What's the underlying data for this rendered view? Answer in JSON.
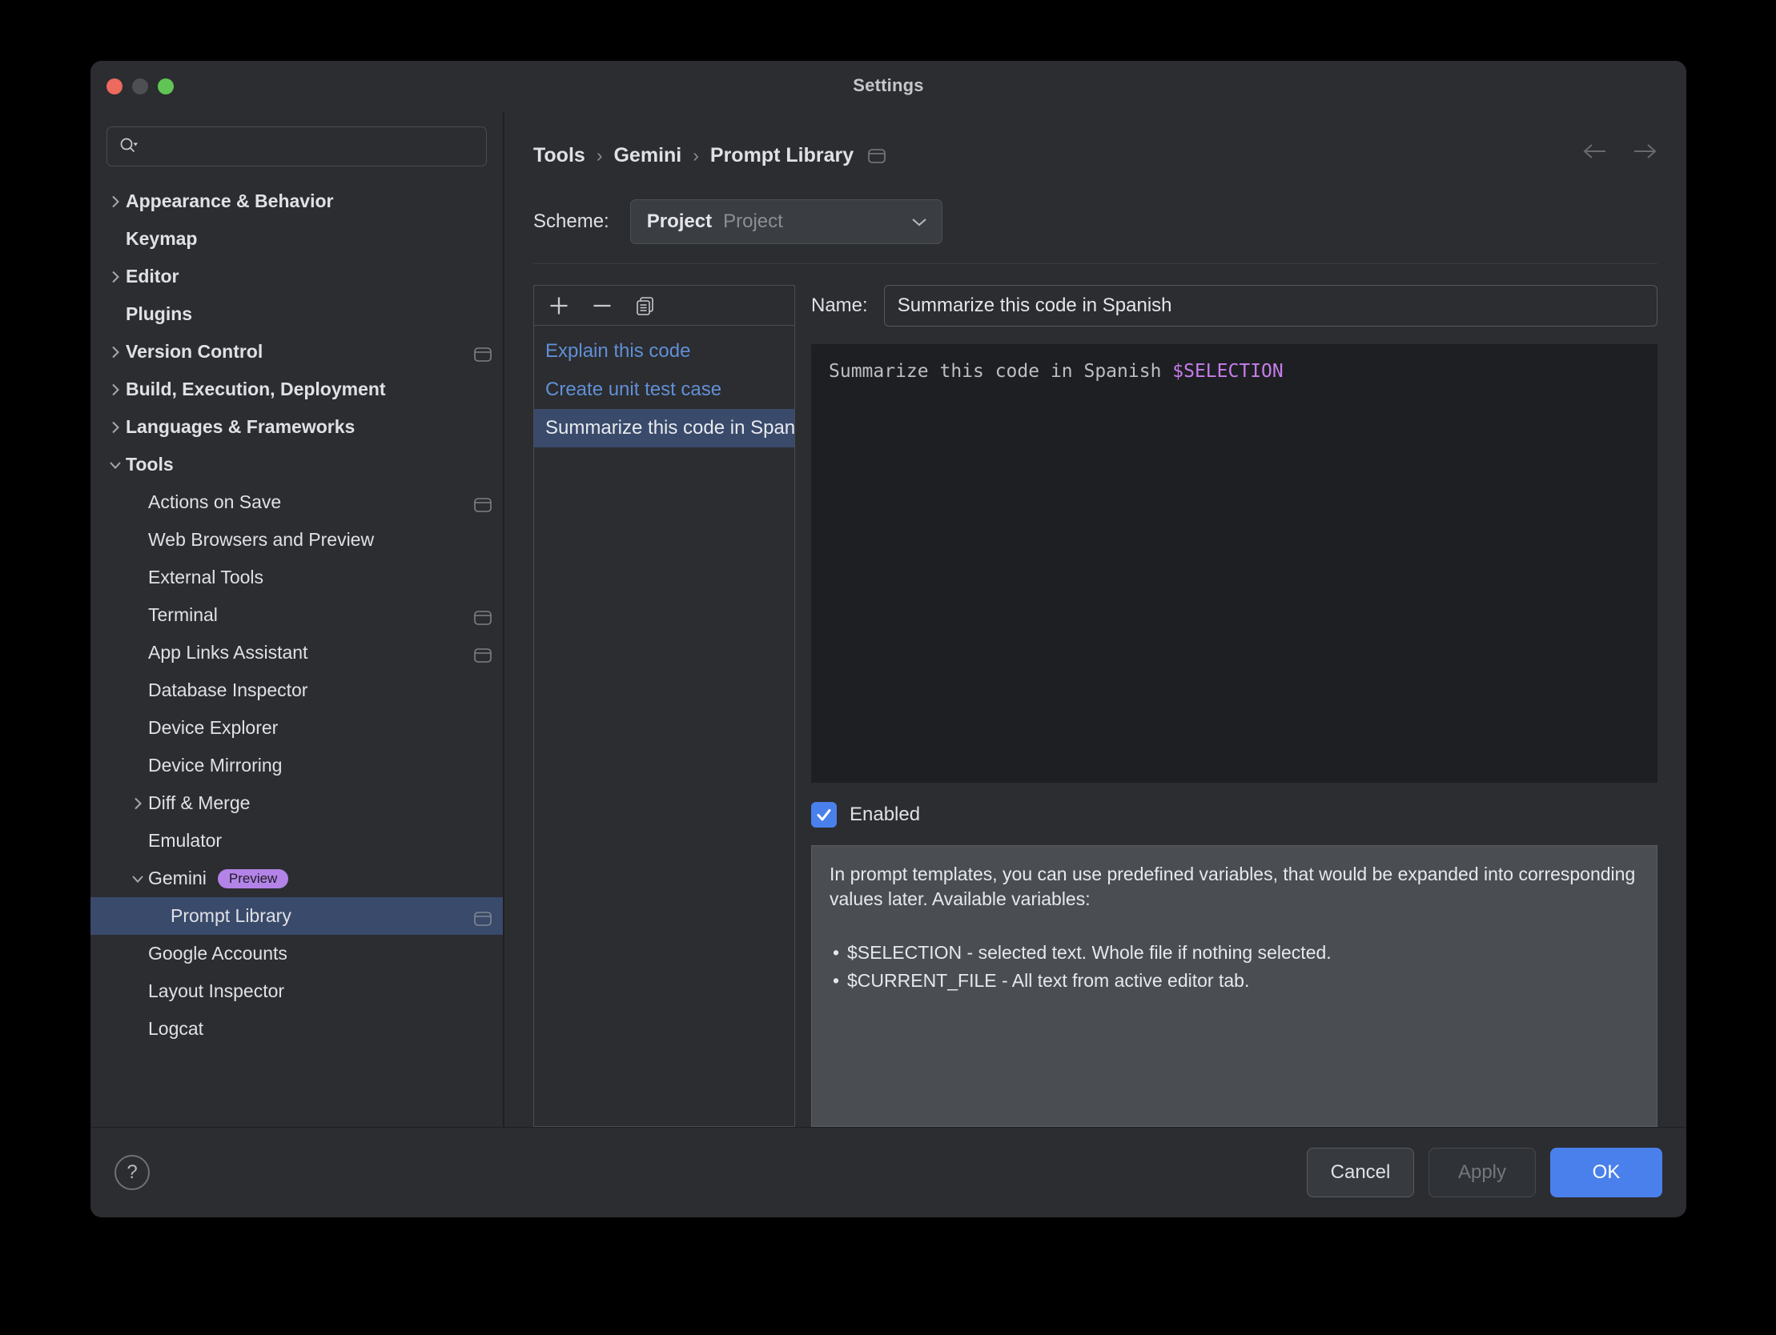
{
  "window": {
    "title": "Settings",
    "traffic_lights": [
      "close-button",
      "minimize-button",
      "maximize-button"
    ]
  },
  "sidebar": {
    "search": {
      "placeholder": "",
      "value": "",
      "icon": "search-icon"
    },
    "items": [
      {
        "label": "Appearance & Behavior",
        "level": 0,
        "arrow": "right",
        "bold": true,
        "scope": false,
        "selected": false
      },
      {
        "label": "Keymap",
        "level": 0,
        "arrow": "none",
        "bold": true,
        "scope": false,
        "selected": false
      },
      {
        "label": "Editor",
        "level": 0,
        "arrow": "right",
        "bold": true,
        "scope": false,
        "selected": false
      },
      {
        "label": "Plugins",
        "level": 0,
        "arrow": "none",
        "bold": true,
        "scope": false,
        "selected": false
      },
      {
        "label": "Version Control",
        "level": 0,
        "arrow": "right",
        "bold": true,
        "scope": true,
        "selected": false
      },
      {
        "label": "Build, Execution, Deployment",
        "level": 0,
        "arrow": "right",
        "bold": true,
        "scope": false,
        "selected": false
      },
      {
        "label": "Languages & Frameworks",
        "level": 0,
        "arrow": "right",
        "bold": true,
        "scope": false,
        "selected": false
      },
      {
        "label": "Tools",
        "level": 0,
        "arrow": "down",
        "bold": true,
        "scope": false,
        "selected": false
      },
      {
        "label": "Actions on Save",
        "level": 1,
        "arrow": "none",
        "bold": false,
        "scope": true,
        "selected": false
      },
      {
        "label": "Web Browsers and Preview",
        "level": 1,
        "arrow": "none",
        "bold": false,
        "scope": false,
        "selected": false
      },
      {
        "label": "External Tools",
        "level": 1,
        "arrow": "none",
        "bold": false,
        "scope": false,
        "selected": false
      },
      {
        "label": "Terminal",
        "level": 1,
        "arrow": "none",
        "bold": false,
        "scope": true,
        "selected": false
      },
      {
        "label": "App Links Assistant",
        "level": 1,
        "arrow": "none",
        "bold": false,
        "scope": true,
        "selected": false
      },
      {
        "label": "Database Inspector",
        "level": 1,
        "arrow": "none",
        "bold": false,
        "scope": false,
        "selected": false
      },
      {
        "label": "Device Explorer",
        "level": 1,
        "arrow": "none",
        "bold": false,
        "scope": false,
        "selected": false
      },
      {
        "label": "Device Mirroring",
        "level": 1,
        "arrow": "none",
        "bold": false,
        "scope": false,
        "selected": false
      },
      {
        "label": "Diff & Merge",
        "level": 1,
        "arrow": "right",
        "bold": false,
        "scope": false,
        "selected": false
      },
      {
        "label": "Emulator",
        "level": 1,
        "arrow": "none",
        "bold": false,
        "scope": false,
        "selected": false
      },
      {
        "label": "Gemini",
        "level": 1,
        "arrow": "down",
        "bold": false,
        "scope": false,
        "selected": false,
        "badge": "Preview"
      },
      {
        "label": "Prompt Library",
        "level": 2,
        "arrow": "none",
        "bold": false,
        "scope": true,
        "selected": true
      },
      {
        "label": "Google Accounts",
        "level": 1,
        "arrow": "none",
        "bold": false,
        "scope": false,
        "selected": false
      },
      {
        "label": "Layout Inspector",
        "level": 1,
        "arrow": "none",
        "bold": false,
        "scope": false,
        "selected": false
      },
      {
        "label": "Logcat",
        "level": 1,
        "arrow": "none",
        "bold": false,
        "scope": false,
        "selected": false
      }
    ]
  },
  "main": {
    "breadcrumb": [
      "Tools",
      "Gemini",
      "Prompt Library"
    ],
    "breadcrumb_separator": "›",
    "nav": {
      "back": "back-arrow-icon",
      "forward": "forward-arrow-icon"
    },
    "scheme": {
      "label": "Scheme:",
      "value": "Project",
      "secondary": "Project",
      "options": [
        "Project"
      ]
    },
    "list_toolbar": {
      "add": "+",
      "remove": "−",
      "copy": "copy-icon"
    },
    "prompts": [
      {
        "label": "Explain this code",
        "selected": false
      },
      {
        "label": "Create unit test case",
        "selected": false
      },
      {
        "label": "Summarize this code in Spanish",
        "selected": true
      }
    ],
    "detail": {
      "name_label": "Name:",
      "name_value": "Summarize this code in Spanish",
      "template_text": "Summarize this code in Spanish ",
      "template_variable": "$SELECTION",
      "enabled_label": "Enabled",
      "enabled_checked": true,
      "info": {
        "paragraph": "In prompt templates, you can use predefined variables, that would be expanded into corresponding values later. Available variables:",
        "bullets": [
          "$SELECTION - selected text. Whole file if nothing selected.",
          "$CURRENT_FILE - All text from active editor tab."
        ]
      }
    }
  },
  "footer": {
    "help": "?",
    "cancel": "Cancel",
    "apply": "Apply",
    "ok": "OK"
  },
  "colors": {
    "window_bg": "#2b2d30",
    "editor_bg": "#1e1f22",
    "selection": "#394a6b",
    "accent": "#4a80eb",
    "link": "#628fd6",
    "badge": "#b383e8",
    "variable": "#c77dea",
    "info_bg": "#4a4e52"
  }
}
